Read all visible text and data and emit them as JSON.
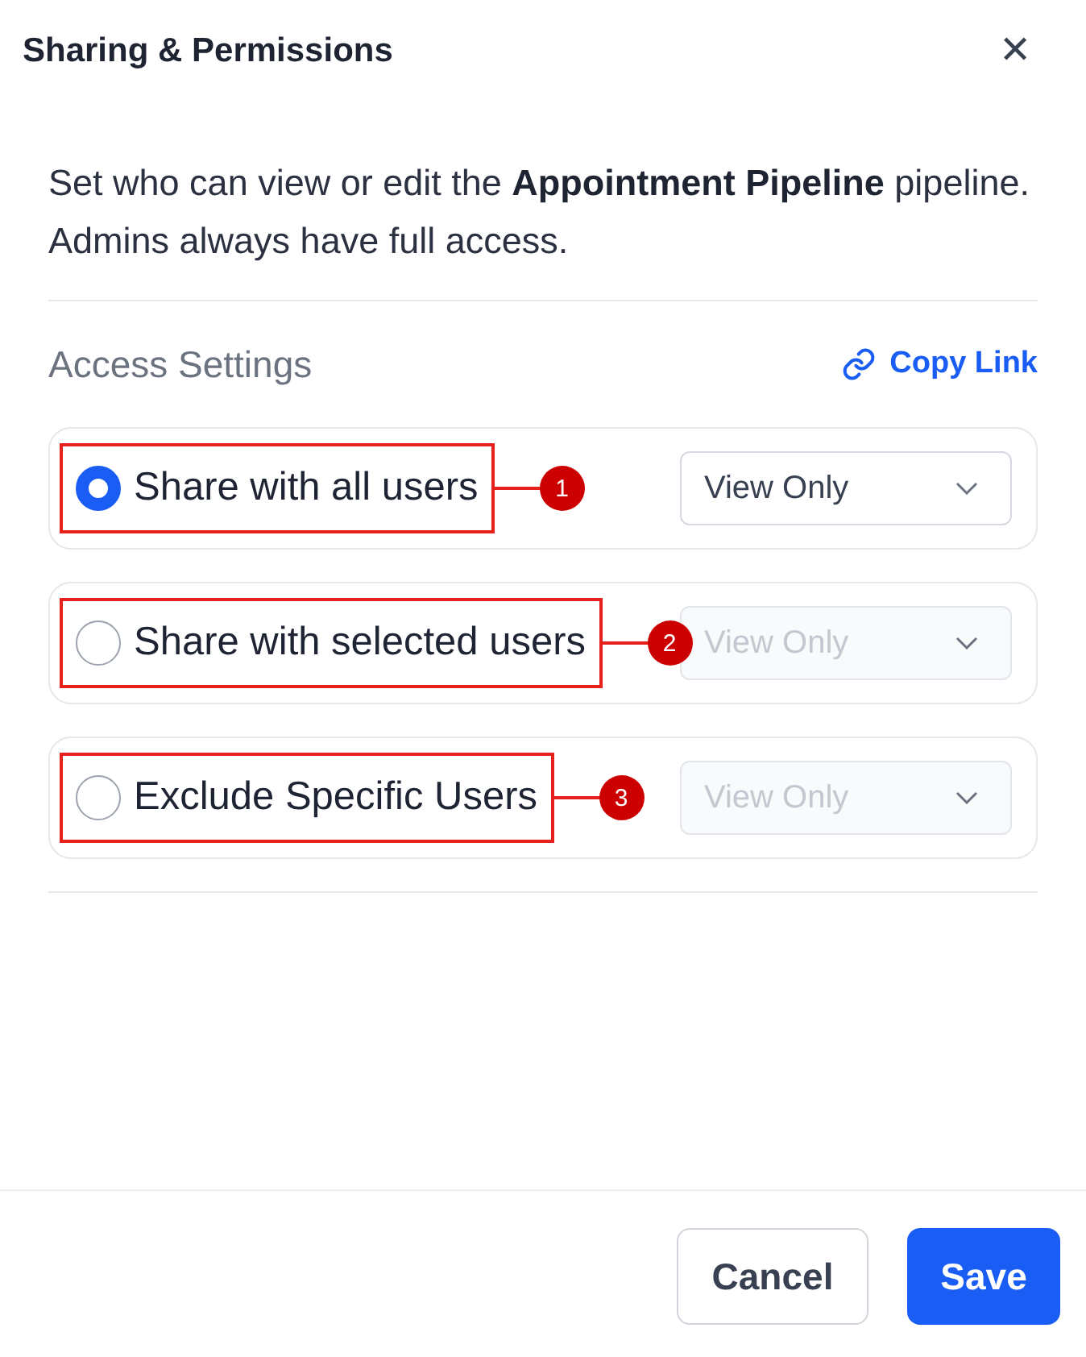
{
  "dialog": {
    "title": "Sharing & Permissions",
    "close": "✕"
  },
  "description": "Set who can view or edit the **Appointment Pipeline** pipeline. Admins always have full access.",
  "section": {
    "title": "Access Settings",
    "link": "Copy Link"
  },
  "options": [
    {
      "label": "Share with all users",
      "selected": true,
      "dropdown": {
        "value": "View Only",
        "disabled": false
      },
      "annotation": "1"
    },
    {
      "label": "Share with selected users",
      "selected": false,
      "dropdown": {
        "value": "View Only",
        "disabled": true
      },
      "annotation": "2"
    },
    {
      "label": "Exclude Specific Users",
      "selected": false,
      "dropdown": {
        "value": "View Only",
        "disabled": true
      },
      "annotation": "3"
    }
  ],
  "buttons": [
    {
      "label": "Cancel",
      "kind": "secondary"
    },
    {
      "label": "Save",
      "kind": "primary"
    }
  ]
}
